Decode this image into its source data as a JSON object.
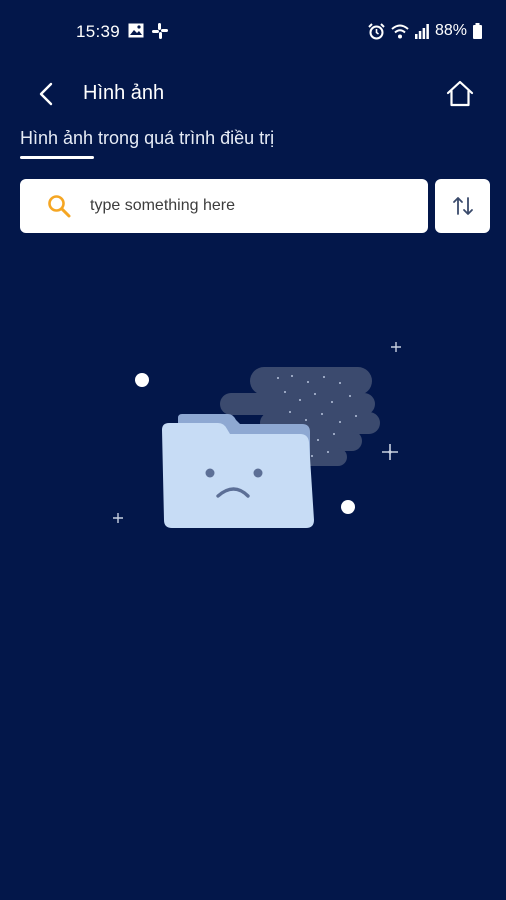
{
  "status_bar": {
    "time": "15:39",
    "battery": "88%",
    "icons": [
      "image-icon",
      "slack-icon",
      "alarm-icon",
      "wifi-icon",
      "signal-icon",
      "battery-icon"
    ]
  },
  "header": {
    "title": "Hình ảnh",
    "back_icon": "chevron-left-icon",
    "home_icon": "home-icon"
  },
  "tabs": [
    {
      "label": "Hình ảnh trong quá trình điều trị",
      "active": true
    }
  ],
  "search": {
    "placeholder": "type something here",
    "value": "",
    "icon": "search-icon",
    "accent_color": "#f5a623"
  },
  "sort_button": {
    "icon": "sort-arrows-icon"
  },
  "empty_state": {
    "illustration": "sad-folder-illustration"
  },
  "colors": {
    "background": "#03174a",
    "card": "#ffffff",
    "folder": "#c7dcf5"
  }
}
